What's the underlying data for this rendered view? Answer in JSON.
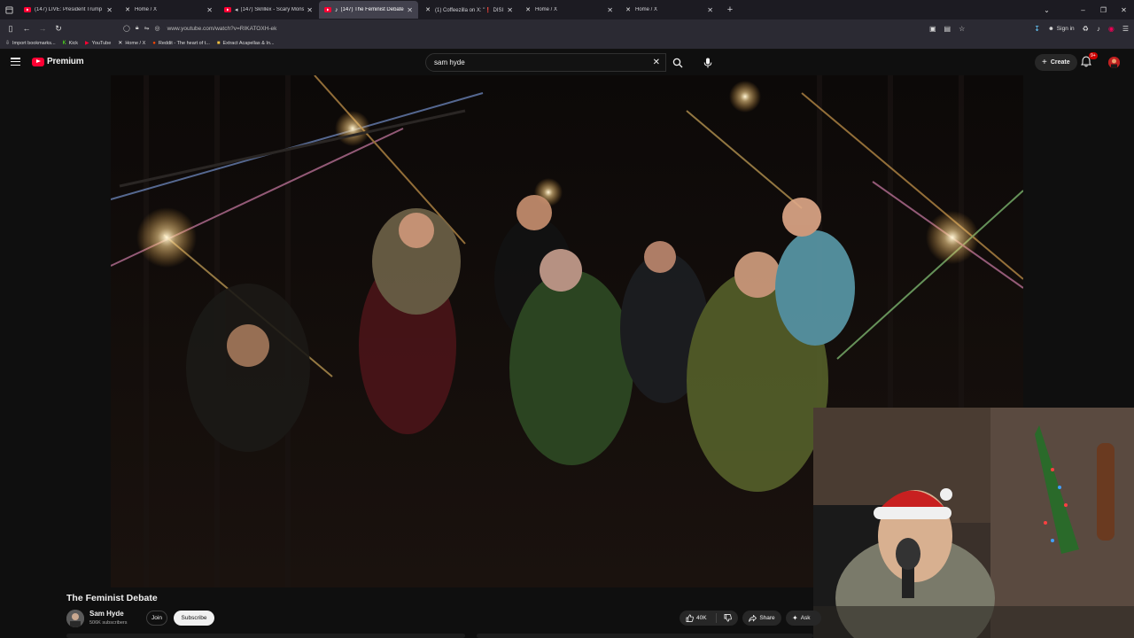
{
  "browser": {
    "tabs": [
      {
        "title": "(147) LIVE: President Trump ma",
        "favicon": "youtube-icon",
        "active": false
      },
      {
        "title": "Home / X",
        "favicon": "x-icon",
        "active": false
      },
      {
        "title": "(147) Skrillex - Scary Monst",
        "favicon": "youtube-icon",
        "active": false
      },
      {
        "title": "(147) The Feminist Debate",
        "favicon": "youtube-icon",
        "active": true
      },
      {
        "title": "(1) Coffeezilla on X: \"❗ DISI",
        "favicon": "x-icon",
        "active": false
      },
      {
        "title": "Home / X",
        "favicon": "x-icon",
        "active": false
      },
      {
        "title": "Home / X",
        "favicon": "x-icon",
        "active": false
      }
    ],
    "url": "www.youtube.com/watch?v=RIKATOXH-ek",
    "signin_label": "Sign in",
    "bookmarks": [
      {
        "label": "Import bookmarks...",
        "icon": "import-icon"
      },
      {
        "label": "Kick",
        "icon": "kick-icon"
      },
      {
        "label": "YouTube",
        "icon": "youtube-icon"
      },
      {
        "label": "Home / X",
        "icon": "x-icon"
      },
      {
        "label": "Reddit - The heart of t...",
        "icon": "reddit-icon"
      },
      {
        "label": "Extract Acapellas & In...",
        "icon": "folder-icon"
      }
    ]
  },
  "youtube": {
    "logo_text": "Premium",
    "search_value": "sam hyde",
    "create_label": "Create",
    "notification_count": "9+"
  },
  "video": {
    "title": "The Feminist Debate",
    "channel_name": "Sam Hyde",
    "subscribers": "506K subscribers",
    "join_label": "Join",
    "subscribe_label": "Subscribe",
    "likes": "40K",
    "share_label": "Share",
    "ask_label": "Ask"
  },
  "colors": {
    "background": "#0f0f0f",
    "brand_red": "#ff0033",
    "tab_bar": "#1c1b22",
    "nav_bar": "#2b2a33"
  }
}
